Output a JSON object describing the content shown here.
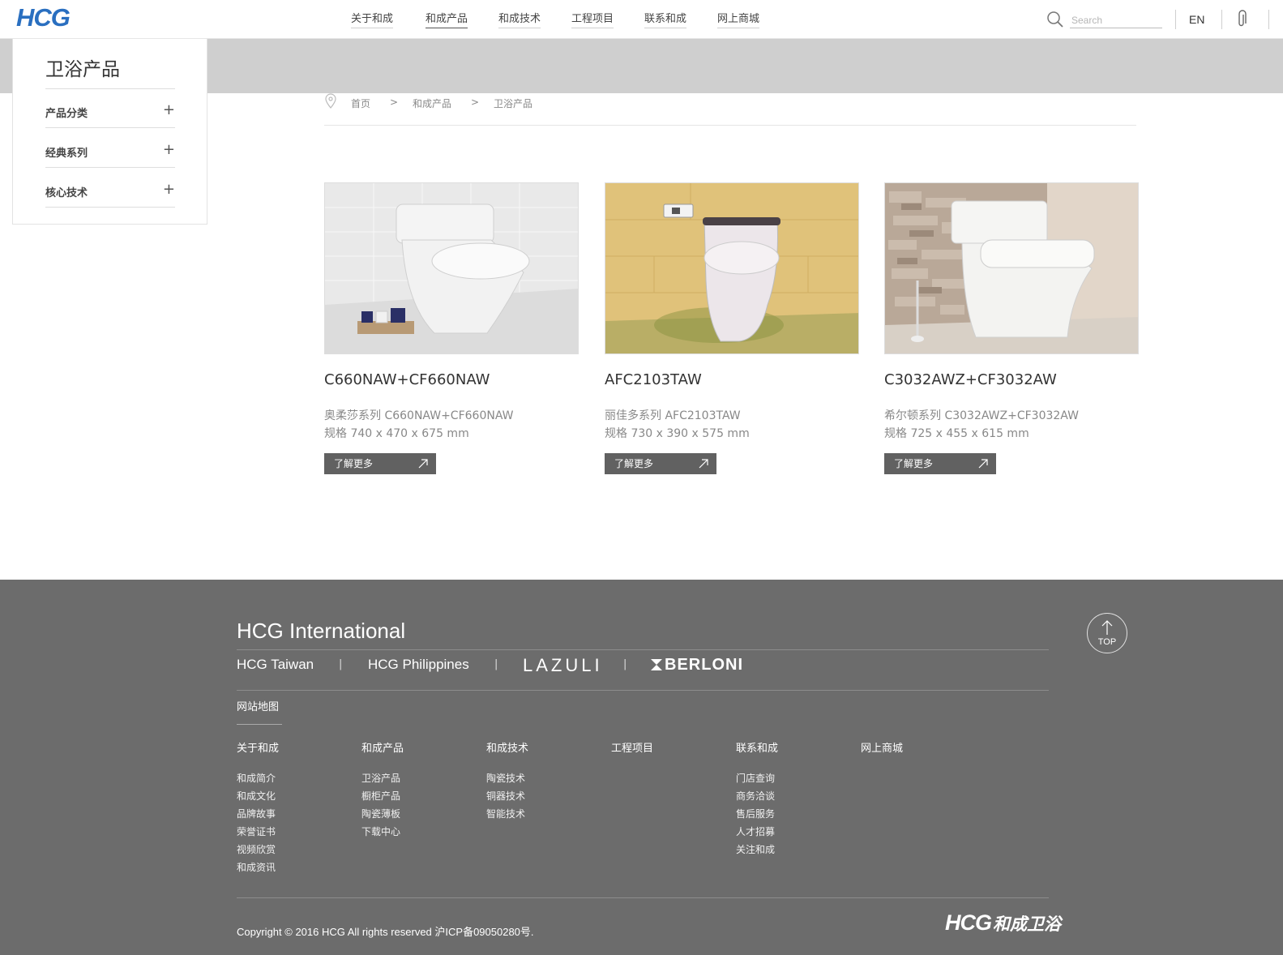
{
  "header": {
    "logo": "HCG",
    "nav": [
      "关于和成",
      "和成产品",
      "和成技术",
      "工程项目",
      "联系和成",
      "网上商城"
    ],
    "search_placeholder": "Search",
    "lang": "EN"
  },
  "sidebar": {
    "title": "卫浴产品",
    "items": [
      {
        "label": "产品分类",
        "icon": "plus-icon"
      },
      {
        "label": "经典系列",
        "icon": "plus-icon"
      },
      {
        "label": "核心技术",
        "icon": "plus-icon"
      }
    ]
  },
  "breadcrumb": {
    "items": [
      "首页",
      "和成产品",
      "卫浴产品"
    ],
    "separator": ">"
  },
  "products": [
    {
      "title": "C660NAW+CF660NAW",
      "series": "奥柔莎系列 C660NAW+CF660NAW",
      "spec": "规格 740 x 470 x 675 mm",
      "button": "了解更多"
    },
    {
      "title": "AFC2103TAW",
      "series": "丽佳多系列 AFC2103TAW",
      "spec": "规格 730 x 390 x 575 mm",
      "button": "了解更多"
    },
    {
      "title": "C3032AWZ+CF3032AW",
      "series": "希尔顿系列 C3032AWZ+CF3032AW",
      "spec": "规格 725 x 455 x 615 mm",
      "button": "了解更多"
    }
  ],
  "footer": {
    "intl": "HCG International",
    "brands": [
      "HCG Taiwan",
      "HCG Philippines",
      "LAZULI",
      "BERLONI"
    ],
    "brand_separator": "|",
    "sitemap": "网站地图",
    "columns": [
      {
        "head": "关于和成",
        "links": [
          "和成简介",
          "和成文化",
          "品牌故事",
          "荣誉证书",
          "视频欣赏",
          "和成资讯"
        ]
      },
      {
        "head": "和成产品",
        "links": [
          "卫浴产品",
          "橱柜产品",
          "陶瓷薄板",
          "下载中心"
        ]
      },
      {
        "head": "和成技术",
        "links": [
          "陶瓷技术",
          "铜器技术",
          "智能技术"
        ]
      },
      {
        "head": "工程项目",
        "links": []
      },
      {
        "head": "联系和成",
        "links": [
          "门店查询",
          "商务洽谈",
          "售后服务",
          "人才招募",
          "关注和成"
        ]
      },
      {
        "head": "网上商城",
        "links": []
      }
    ],
    "copyright": "Copyright © 2016 HCG All rights reserved 沪ICP备09050280号.",
    "logo_en": "HCG",
    "logo_cn": "和成卫浴",
    "top_label": "TOP"
  },
  "colors": {
    "brand_blue": "#2a6fc0",
    "banner_grey": "#cfcfcf",
    "footer_grey": "#6c6c6c",
    "button_grey": "#616161"
  }
}
